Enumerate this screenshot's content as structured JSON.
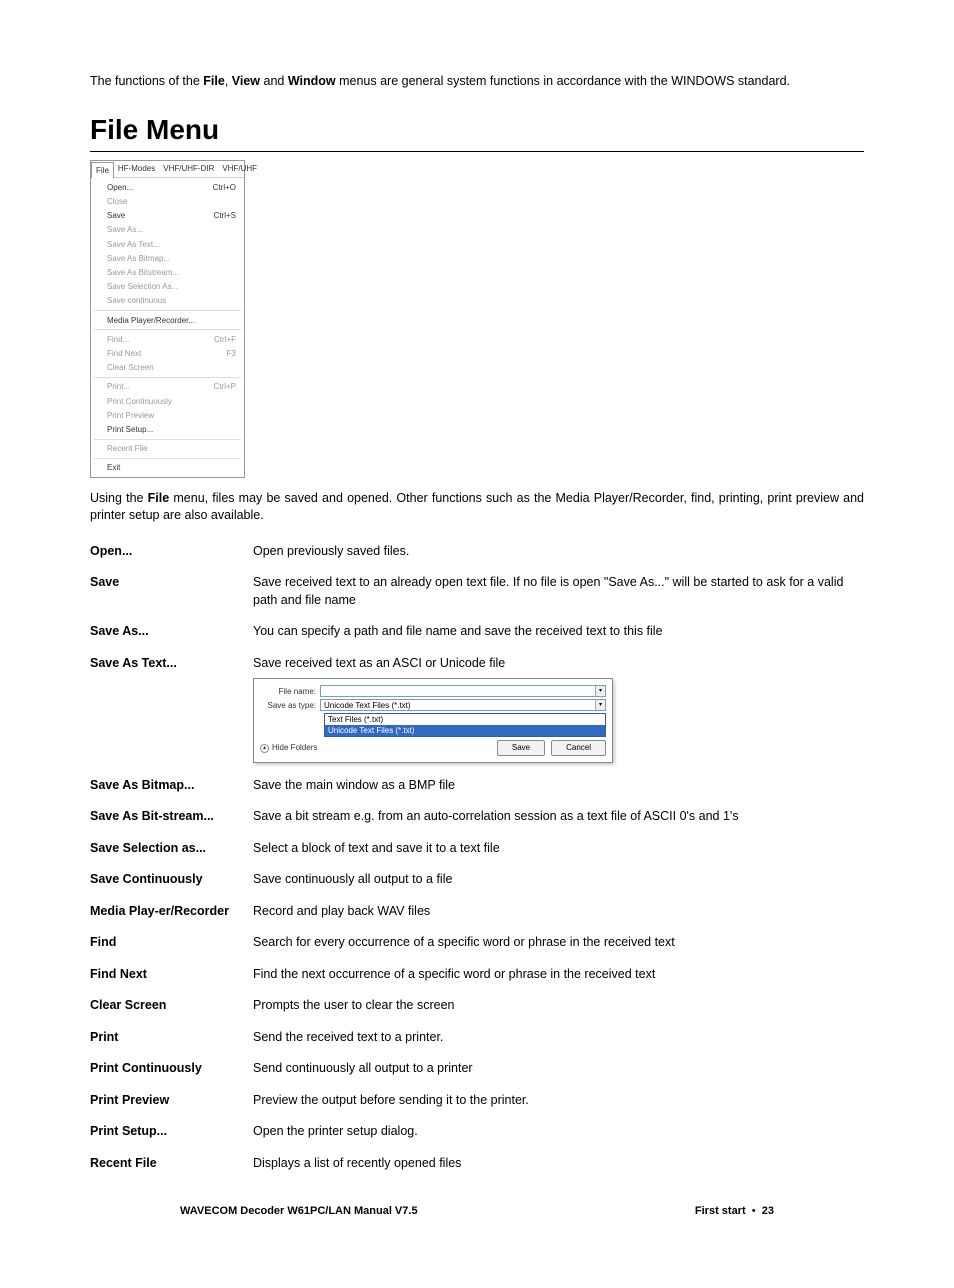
{
  "intro": {
    "pre": "The functions of the ",
    "b1": "File",
    "mid1": ", ",
    "b2": "View",
    "mid2": " and ",
    "b3": "Window",
    "post": " menus are general system functions in accordance with the WINDOWS standard."
  },
  "heading": "File Menu",
  "menu": {
    "tabs": [
      "File",
      "HF-Modes",
      "VHF/UHF-DIR",
      "VHF/UHF"
    ],
    "groups": [
      [
        {
          "label": "Open...",
          "shortcut": "Ctrl+O"
        },
        {
          "label": "Close",
          "shortcut": "",
          "disabled": true
        },
        {
          "label": "Save",
          "shortcut": "Ctrl+S"
        },
        {
          "label": "Save As...",
          "shortcut": "",
          "disabled": true
        },
        {
          "label": "Save As Text...",
          "shortcut": "",
          "disabled": true
        },
        {
          "label": "Save As Bitmap...",
          "shortcut": "",
          "disabled": true
        },
        {
          "label": "Save As Bitstream...",
          "shortcut": "",
          "disabled": true
        },
        {
          "label": "Save Selection As...",
          "shortcut": "",
          "disabled": true
        },
        {
          "label": "Save continuous",
          "shortcut": "",
          "disabled": true
        }
      ],
      [
        {
          "label": "Media Player/Recorder...",
          "shortcut": ""
        }
      ],
      [
        {
          "label": "Find...",
          "shortcut": "Ctrl+F",
          "disabled": true
        },
        {
          "label": "Find Next",
          "shortcut": "F3",
          "disabled": true
        },
        {
          "label": "Clear Screen",
          "shortcut": "",
          "disabled": true
        }
      ],
      [
        {
          "label": "Print...",
          "shortcut": "Ctrl+P",
          "disabled": true
        },
        {
          "label": "Print Continuously",
          "shortcut": "",
          "disabled": true
        },
        {
          "label": "Print Preview",
          "shortcut": "",
          "disabled": true
        },
        {
          "label": "Print Setup...",
          "shortcut": ""
        }
      ],
      [
        {
          "label": "Recent File",
          "shortcut": "",
          "disabled": true
        }
      ],
      [
        {
          "label": "Exit",
          "shortcut": ""
        }
      ]
    ]
  },
  "para2": {
    "pre": "Using the ",
    "b": "File",
    "post": " menu, files may be saved and opened. Other functions such as the Media Player/Recorder, find, printing, print preview and printer setup are also available."
  },
  "defs": [
    {
      "term": "Open...",
      "desc": "Open previously saved files."
    },
    {
      "term": "Save",
      "desc": "Save received text to an already open text file. If no file is open \"Save As...\" will be started to ask for a valid path and file name"
    },
    {
      "term": "Save As...",
      "desc": "You can specify a path and file name and save the received text to this file"
    },
    {
      "term": "Save As Text...",
      "desc": "Save received text as an ASCI or Unicode file"
    },
    {
      "term": "Save As Bitmap...",
      "desc": "Save the main window as a BMP file"
    },
    {
      "term": "Save As Bit-stream...",
      "desc": "Save a bit stream e.g. from an auto-correlation session as a text file of ASCII 0's and 1's"
    },
    {
      "term": "Save Selection as...",
      "desc": "Select a block of text and save it to a text file"
    },
    {
      "term": "Save Continuously",
      "desc": "Save continuously all output to a file"
    },
    {
      "term": "Media Play-er/Recorder",
      "desc": "Record and play back WAV files"
    },
    {
      "term": "Find",
      "desc": "Search for every occurrence of a specific word or phrase in the received text"
    },
    {
      "term": "Find Next",
      "desc": "Find the next occurrence of a specific word or phrase in the received text"
    },
    {
      "term": "Clear Screen",
      "desc": "Prompts the user to clear the screen"
    },
    {
      "term": "Print",
      "desc": "Send the received text to a printer."
    },
    {
      "term": "Print Continuously",
      "desc": "Send continuously all output to a printer"
    },
    {
      "term": "Print Preview",
      "desc": "Preview the output before sending it to the printer."
    },
    {
      "term": "Print Setup...",
      "desc": "Open the printer setup dialog."
    },
    {
      "term": "Recent File",
      "desc": "Displays a list of recently opened files"
    }
  ],
  "saveas": {
    "filename_label": "File name:",
    "type_label": "Save as type:",
    "type_value": "Unicode Text Files (*.txt)",
    "options": [
      "Text Files (*.txt)",
      "Unicode Text Files (*.txt)"
    ],
    "hide": "Hide Folders",
    "save": "Save",
    "cancel": "Cancel"
  },
  "footer": {
    "left": "WAVECOM Decoder W61PC/LAN Manual V7.5",
    "right_label": "First start",
    "bullet": "•",
    "page": "23"
  }
}
